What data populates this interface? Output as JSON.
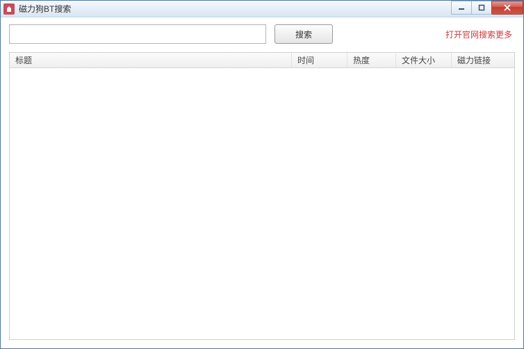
{
  "window": {
    "title": "磁力狗BT搜索"
  },
  "search": {
    "value": "",
    "placeholder": "",
    "button_label": "搜索"
  },
  "link_more": "打开官网搜索更多",
  "columns": {
    "title": "标题",
    "time": "时间",
    "heat": "热度",
    "size": "文件大小",
    "magnet": "磁力链接"
  },
  "rows": []
}
